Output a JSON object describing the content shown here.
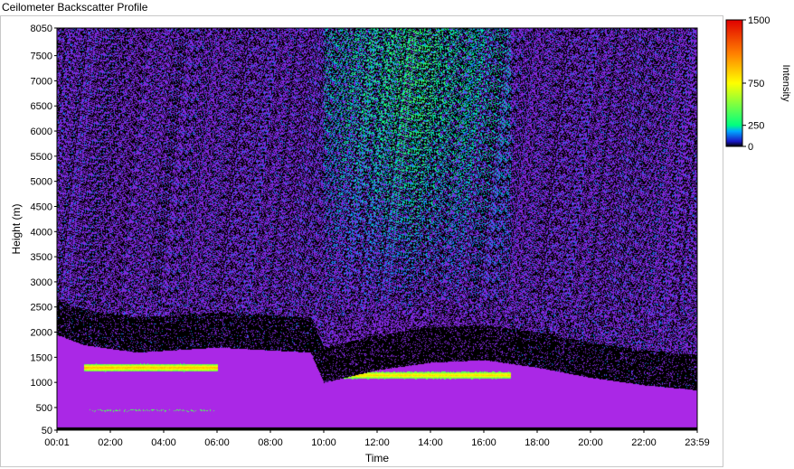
{
  "title": "Ceilometer Backscatter Profile",
  "colorbar": {
    "label": "Intensity",
    "ticks": [
      "1500",
      "750",
      "250",
      "0"
    ],
    "stops": [
      {
        "value": 0,
        "color": "#000000"
      },
      {
        "value": 60,
        "color": "#1818c8"
      },
      {
        "value": 180,
        "color": "#00a8ff"
      },
      {
        "value": 250,
        "color": "#00ff80"
      },
      {
        "value": 750,
        "color": "#ffff00"
      },
      {
        "value": 1100,
        "color": "#ff8000"
      },
      {
        "value": 1500,
        "color": "#e00000"
      }
    ]
  },
  "chart_data": {
    "type": "heatmap",
    "title": "Ceilometer Backscatter Profile",
    "xlabel": "Time",
    "ylabel": "Height (m)",
    "xlim": [
      "00:01",
      "23:59"
    ],
    "ylim": [
      50,
      8050
    ],
    "x_ticks": [
      "00:01",
      "02:00",
      "04:00",
      "06:00",
      "08:00",
      "10:00",
      "12:00",
      "14:00",
      "16:00",
      "18:00",
      "20:00",
      "22:00",
      "23:59"
    ],
    "y_ticks": [
      "8050",
      "7500",
      "7000",
      "6500",
      "6000",
      "5500",
      "5000",
      "4500",
      "4000",
      "3500",
      "3000",
      "2500",
      "2000",
      "1500",
      "1000",
      "500",
      "50"
    ],
    "colorbar_range": [
      0,
      1500
    ],
    "boundary_layer_top_m": [
      {
        "time_h": 0,
        "height_m": 1950
      },
      {
        "time_h": 1,
        "height_m": 1750
      },
      {
        "time_h": 3,
        "height_m": 1600
      },
      {
        "time_h": 6,
        "height_m": 1700
      },
      {
        "time_h": 9.5,
        "height_m": 1600
      },
      {
        "time_h": 10,
        "height_m": 1000
      },
      {
        "time_h": 12,
        "height_m": 1250
      },
      {
        "time_h": 14,
        "height_m": 1400
      },
      {
        "time_h": 16,
        "height_m": 1450
      },
      {
        "time_h": 18,
        "height_m": 1300
      },
      {
        "time_h": 20,
        "height_m": 1100
      },
      {
        "time_h": 22,
        "height_m": 950
      },
      {
        "time_h": 24,
        "height_m": 850
      }
    ],
    "cloud_layers": [
      {
        "start_h": 1.0,
        "end_h": 6.0,
        "height_m": 1300,
        "intensity": 900
      },
      {
        "start_h": 10.0,
        "end_h": 17.0,
        "height_m": 1150,
        "intensity": 800
      },
      {
        "start_h": 1.2,
        "end_h": 6.0,
        "height_m": 450,
        "intensity": 300
      }
    ],
    "upper_noise_peak": {
      "start_h": 10,
      "end_h": 17,
      "intensity": 250
    }
  }
}
